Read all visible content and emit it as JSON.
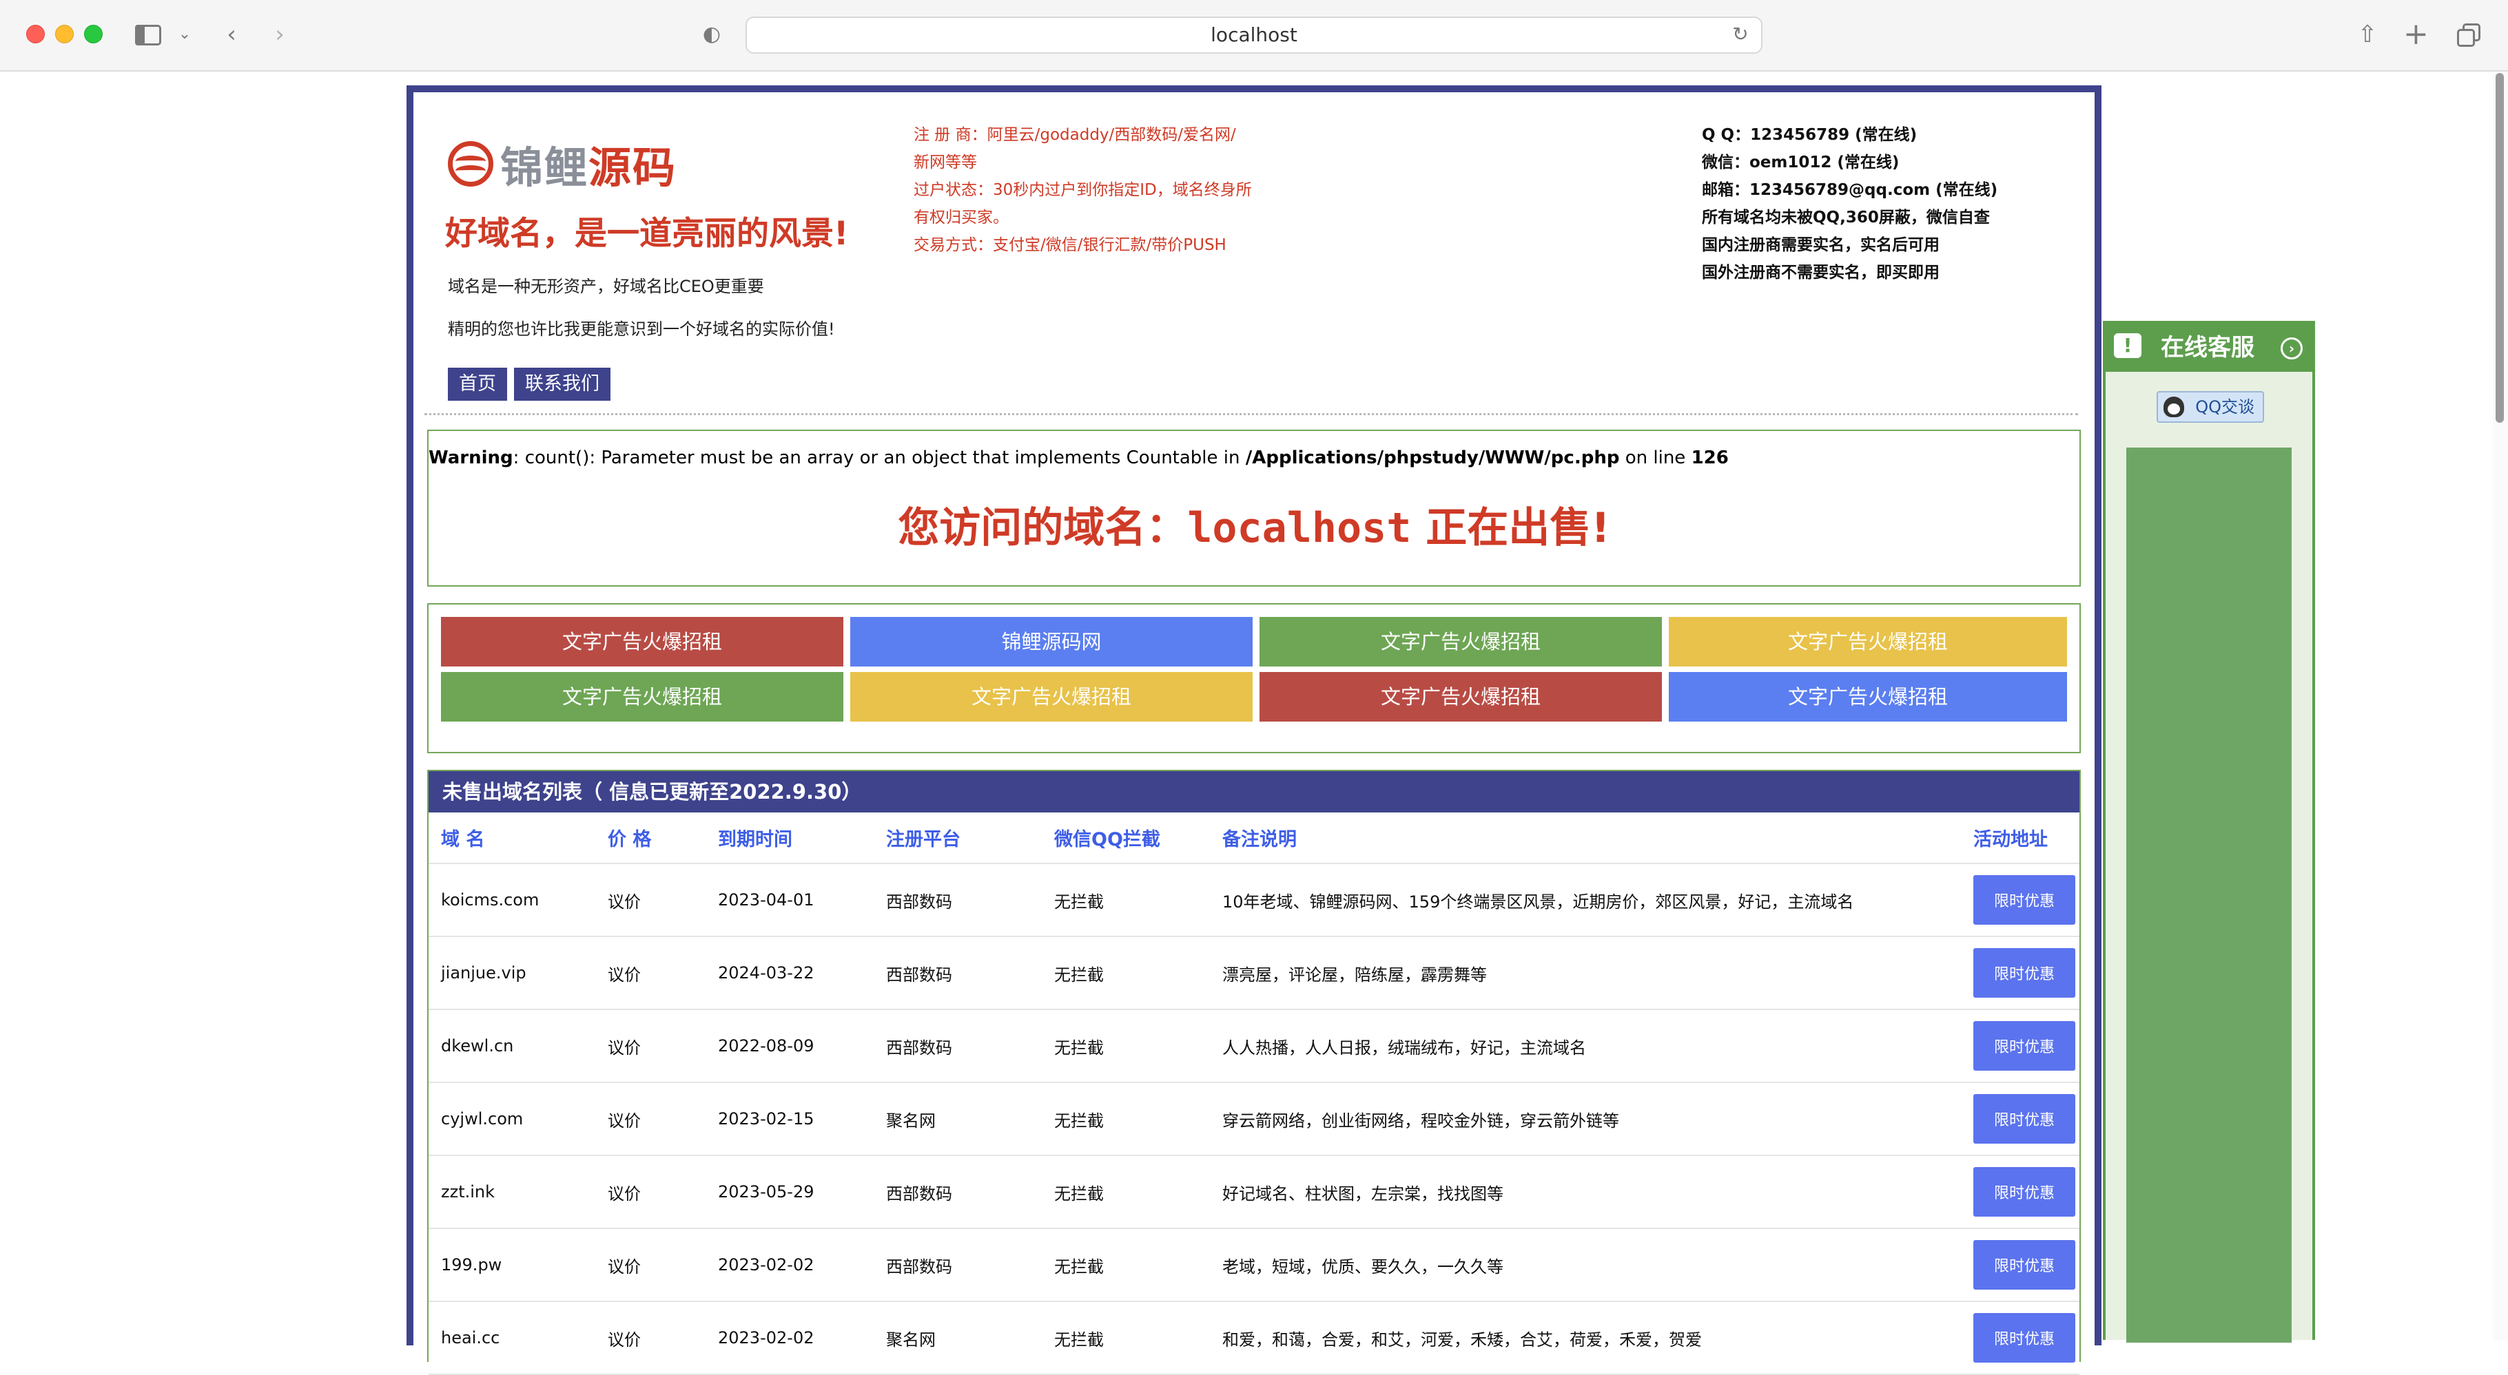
{
  "browser": {
    "url": "localhost"
  },
  "header": {
    "logo_part1": "锦鲤",
    "logo_part2": "源码",
    "slogan": "好域名，是一道亮丽的风景!",
    "desc1": "域名是一种无形资产，好域名比CEO更重要",
    "desc2": "精明的您也许比我更能意识到一个好域名的实际价值!",
    "nav": [
      "首页",
      "联系我们"
    ]
  },
  "registrar": {
    "lines": [
      "注 册 商：阿里云/godaddy/西部数码/爱名网/",
      "新网等等",
      "过户状态：30秒内过户到你指定ID，域名终身所",
      "有权归买家。",
      "交易方式：支付宝/微信/银行汇款/带价PUSH"
    ]
  },
  "contact": {
    "lines": [
      "Q Q：123456789 (常在线)",
      "微信：oem1012 (常在线)",
      "邮箱：123456789@qq.com (常在线)",
      "所有域名均未被QQ,360屏蔽，微信自查",
      "国内注册商需要实名，实名后可用",
      "国外注册商不需要实名，即买即用"
    ]
  },
  "warning": {
    "label": "Warning",
    "message": ": count(): Parameter must be an array or an object that implements Countable in ",
    "path": "/Applications/phpstudy/WWW/pc.php",
    "on_line": " on line ",
    "line_no": "126"
  },
  "sale": {
    "prefix": "您访问的域名：",
    "domain": "localhost",
    "suffix": " 正在出售!"
  },
  "ads": [
    {
      "label": "文字广告火爆招租",
      "color": "#b84c45"
    },
    {
      "label": "锦鲤源码网",
      "color": "#5b7ff0"
    },
    {
      "label": "文字广告火爆招租",
      "color": "#6ea655"
    },
    {
      "label": "文字广告火爆招租",
      "color": "#e8c24a"
    },
    {
      "label": "文字广告火爆招租",
      "color": "#6ea655"
    },
    {
      "label": "文字广告火爆招租",
      "color": "#e8c24a"
    },
    {
      "label": "文字广告火爆招租",
      "color": "#b84c45"
    },
    {
      "label": "文字广告火爆招租",
      "color": "#5b7ff0"
    }
  ],
  "table": {
    "title": "未售出域名列表（ 信息已更新至2022.9.30）",
    "headers": [
      "域 名",
      "价 格",
      "到期时间",
      "注册平台",
      "微信QQ拦截",
      "备注说明",
      "活动地址"
    ],
    "rows": [
      [
        "koicms.com",
        "议价",
        "2023-04-01",
        "西部数码",
        "无拦截",
        "10年老域、锦鲤源码网、159个终端景区风景，近期房价，郊区风景，好记，主流域名",
        "限时优惠"
      ],
      [
        "jianjue.vip",
        "议价",
        "2024-03-22",
        "西部数码",
        "无拦截",
        "漂亮屋，评论屋，陪练屋，霹雳舞等",
        "限时优惠"
      ],
      [
        "dkewl.cn",
        "议价",
        "2022-08-09",
        "西部数码",
        "无拦截",
        "人人热播，人人日报，绒瑞绒布，好记，主流域名",
        "限时优惠"
      ],
      [
        "cyjwl.com",
        "议价",
        "2023-02-15",
        "聚名网",
        "无拦截",
        "穿云箭网络，创业街网络，程咬金外链，穿云箭外链等",
        "限时优惠"
      ],
      [
        "zzt.ink",
        "议价",
        "2023-05-29",
        "西部数码",
        "无拦截",
        "好记域名、柱状图，左宗棠，找找图等",
        "限时优惠"
      ],
      [
        "199.pw",
        "议价",
        "2023-02-02",
        "西部数码",
        "无拦截",
        "老域，短域，优质、要久久，一久久等",
        "限时优惠"
      ],
      [
        "heai.cc",
        "议价",
        "2023-02-02",
        "聚名网",
        "无拦截",
        "和爱，和蔼，合爱，和艾，河爱，禾矮，合艾，荷爱，禾爱，贺爱",
        "限时优惠"
      ]
    ]
  },
  "side": {
    "title": "在线客服",
    "qq_label": "QQ交谈",
    "theme": "#5d9e4d"
  }
}
